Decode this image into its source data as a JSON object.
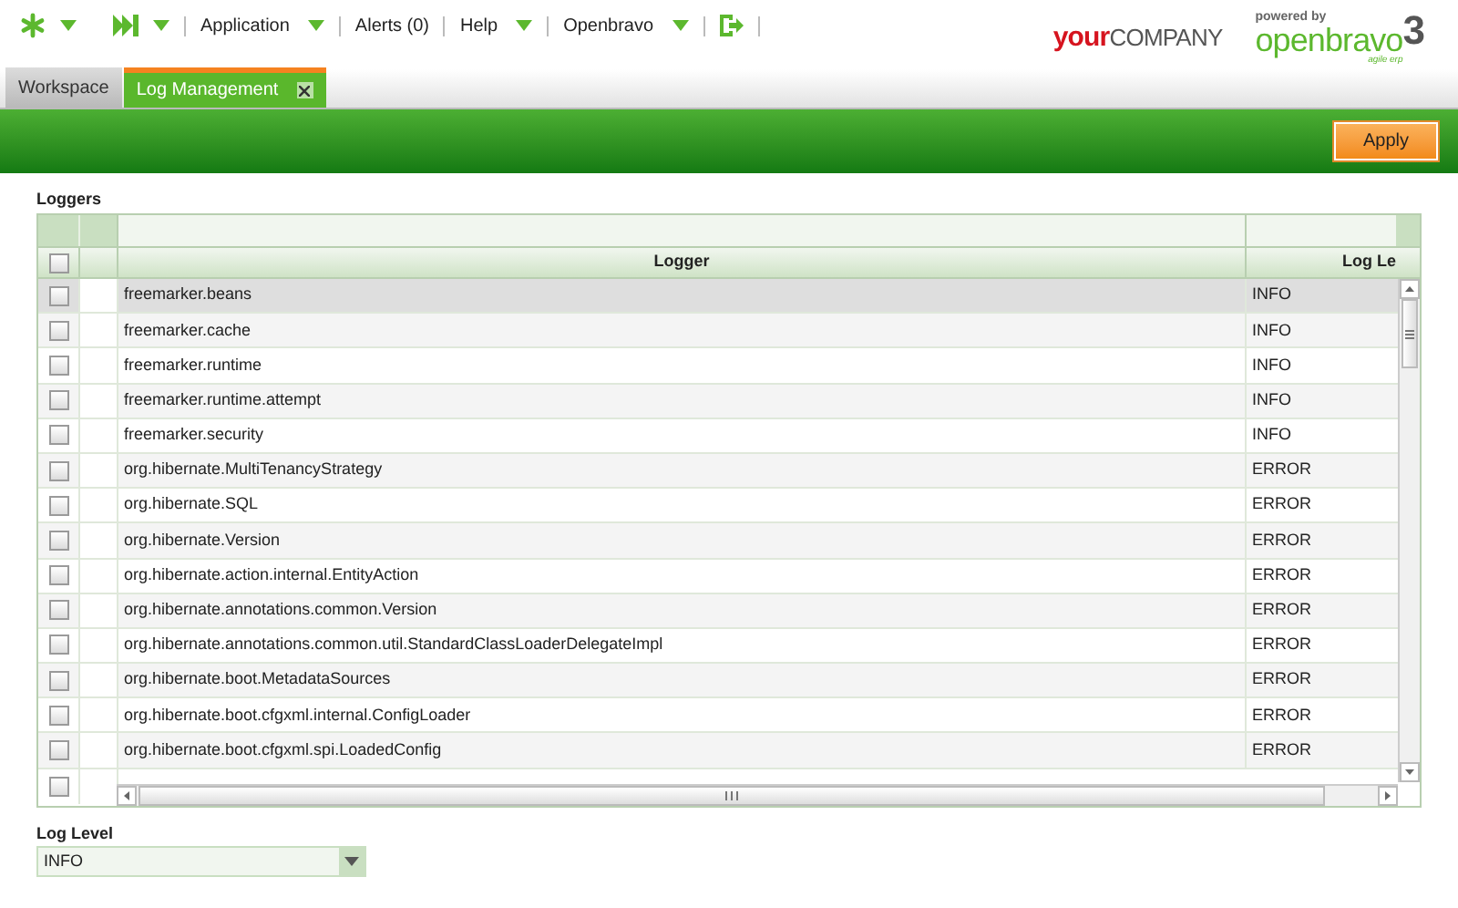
{
  "toolbar": {
    "items": [
      {
        "kind": "icon"
      },
      {
        "kind": "icon"
      },
      {
        "kind": "menu",
        "label": "Application"
      },
      {
        "kind": "text",
        "label": "Alerts (0)"
      },
      {
        "kind": "menu",
        "label": "Help"
      },
      {
        "kind": "menu",
        "label": "Openbravo"
      },
      {
        "kind": "icon"
      }
    ],
    "company_logo": {
      "first": "your",
      "second": "COMPANY"
    },
    "powered_logo": {
      "caption": "powered by",
      "name": "openbravo",
      "version": "3",
      "tagline": "agile erp"
    }
  },
  "tabs": [
    {
      "label": "Workspace",
      "selected": false,
      "closable": false
    },
    {
      "label": "Log Management",
      "selected": true,
      "closable": true
    }
  ],
  "apply_button": "Apply",
  "loggers": {
    "title": "Loggers",
    "columns": [
      "Logger",
      "Log Le"
    ],
    "all_checked": false,
    "rows": [
      {
        "name": "freemarker.beans",
        "level": "INFO",
        "checked": false,
        "selected": true
      },
      {
        "name": "freemarker.cache",
        "level": "INFO",
        "checked": false,
        "selected": false
      },
      {
        "name": "freemarker.runtime",
        "level": "INFO",
        "checked": false,
        "selected": false
      },
      {
        "name": "freemarker.runtime.attempt",
        "level": "INFO",
        "checked": false,
        "selected": false
      },
      {
        "name": "freemarker.security",
        "level": "INFO",
        "checked": false,
        "selected": false
      },
      {
        "name": "org.hibernate.MultiTenancyStrategy",
        "level": "ERROR",
        "checked": false,
        "selected": false
      },
      {
        "name": "org.hibernate.SQL",
        "level": "ERROR",
        "checked": false,
        "selected": false
      },
      {
        "name": "org.hibernate.Version",
        "level": "ERROR",
        "checked": false,
        "selected": false
      },
      {
        "name": "org.hibernate.action.internal.EntityAction",
        "level": "ERROR",
        "checked": false,
        "selected": false
      },
      {
        "name": "org.hibernate.annotations.common.Version",
        "level": "ERROR",
        "checked": false,
        "selected": false
      },
      {
        "name": "org.hibernate.annotations.common.util.StandardClassLoaderDelegateImpl",
        "level": "ERROR",
        "checked": false,
        "selected": false
      },
      {
        "name": "org.hibernate.boot.MetadataSources",
        "level": "ERROR",
        "checked": false,
        "selected": false
      },
      {
        "name": "org.hibernate.boot.cfgxml.internal.ConfigLoader",
        "level": "ERROR",
        "checked": false,
        "selected": false
      },
      {
        "name": "org.hibernate.boot.cfgxml.spi.LoadedConfig",
        "level": "ERROR",
        "checked": false,
        "selected": false
      }
    ],
    "partial_row": {
      "checked": false
    }
  },
  "log_level": {
    "label": "Log Level",
    "value": "INFO"
  }
}
